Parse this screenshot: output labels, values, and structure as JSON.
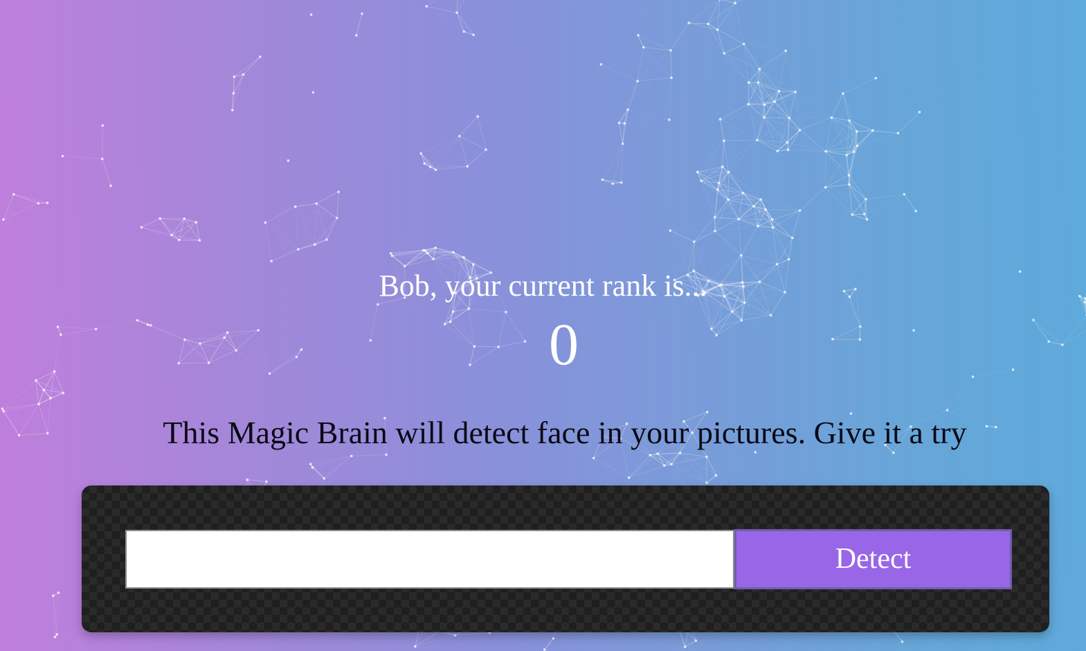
{
  "rank": {
    "message": "Bob, your current rank is...",
    "value": "0"
  },
  "tagline": "This Magic Brain will detect face in your pictures. Give it a try",
  "form": {
    "input_value": "",
    "input_placeholder": "",
    "detect_label": "Detect"
  },
  "colors": {
    "gradient_left": "#bf7fdc",
    "gradient_right": "#5eaadb",
    "button": "#9966e8",
    "panel": "#1f1f1f"
  }
}
